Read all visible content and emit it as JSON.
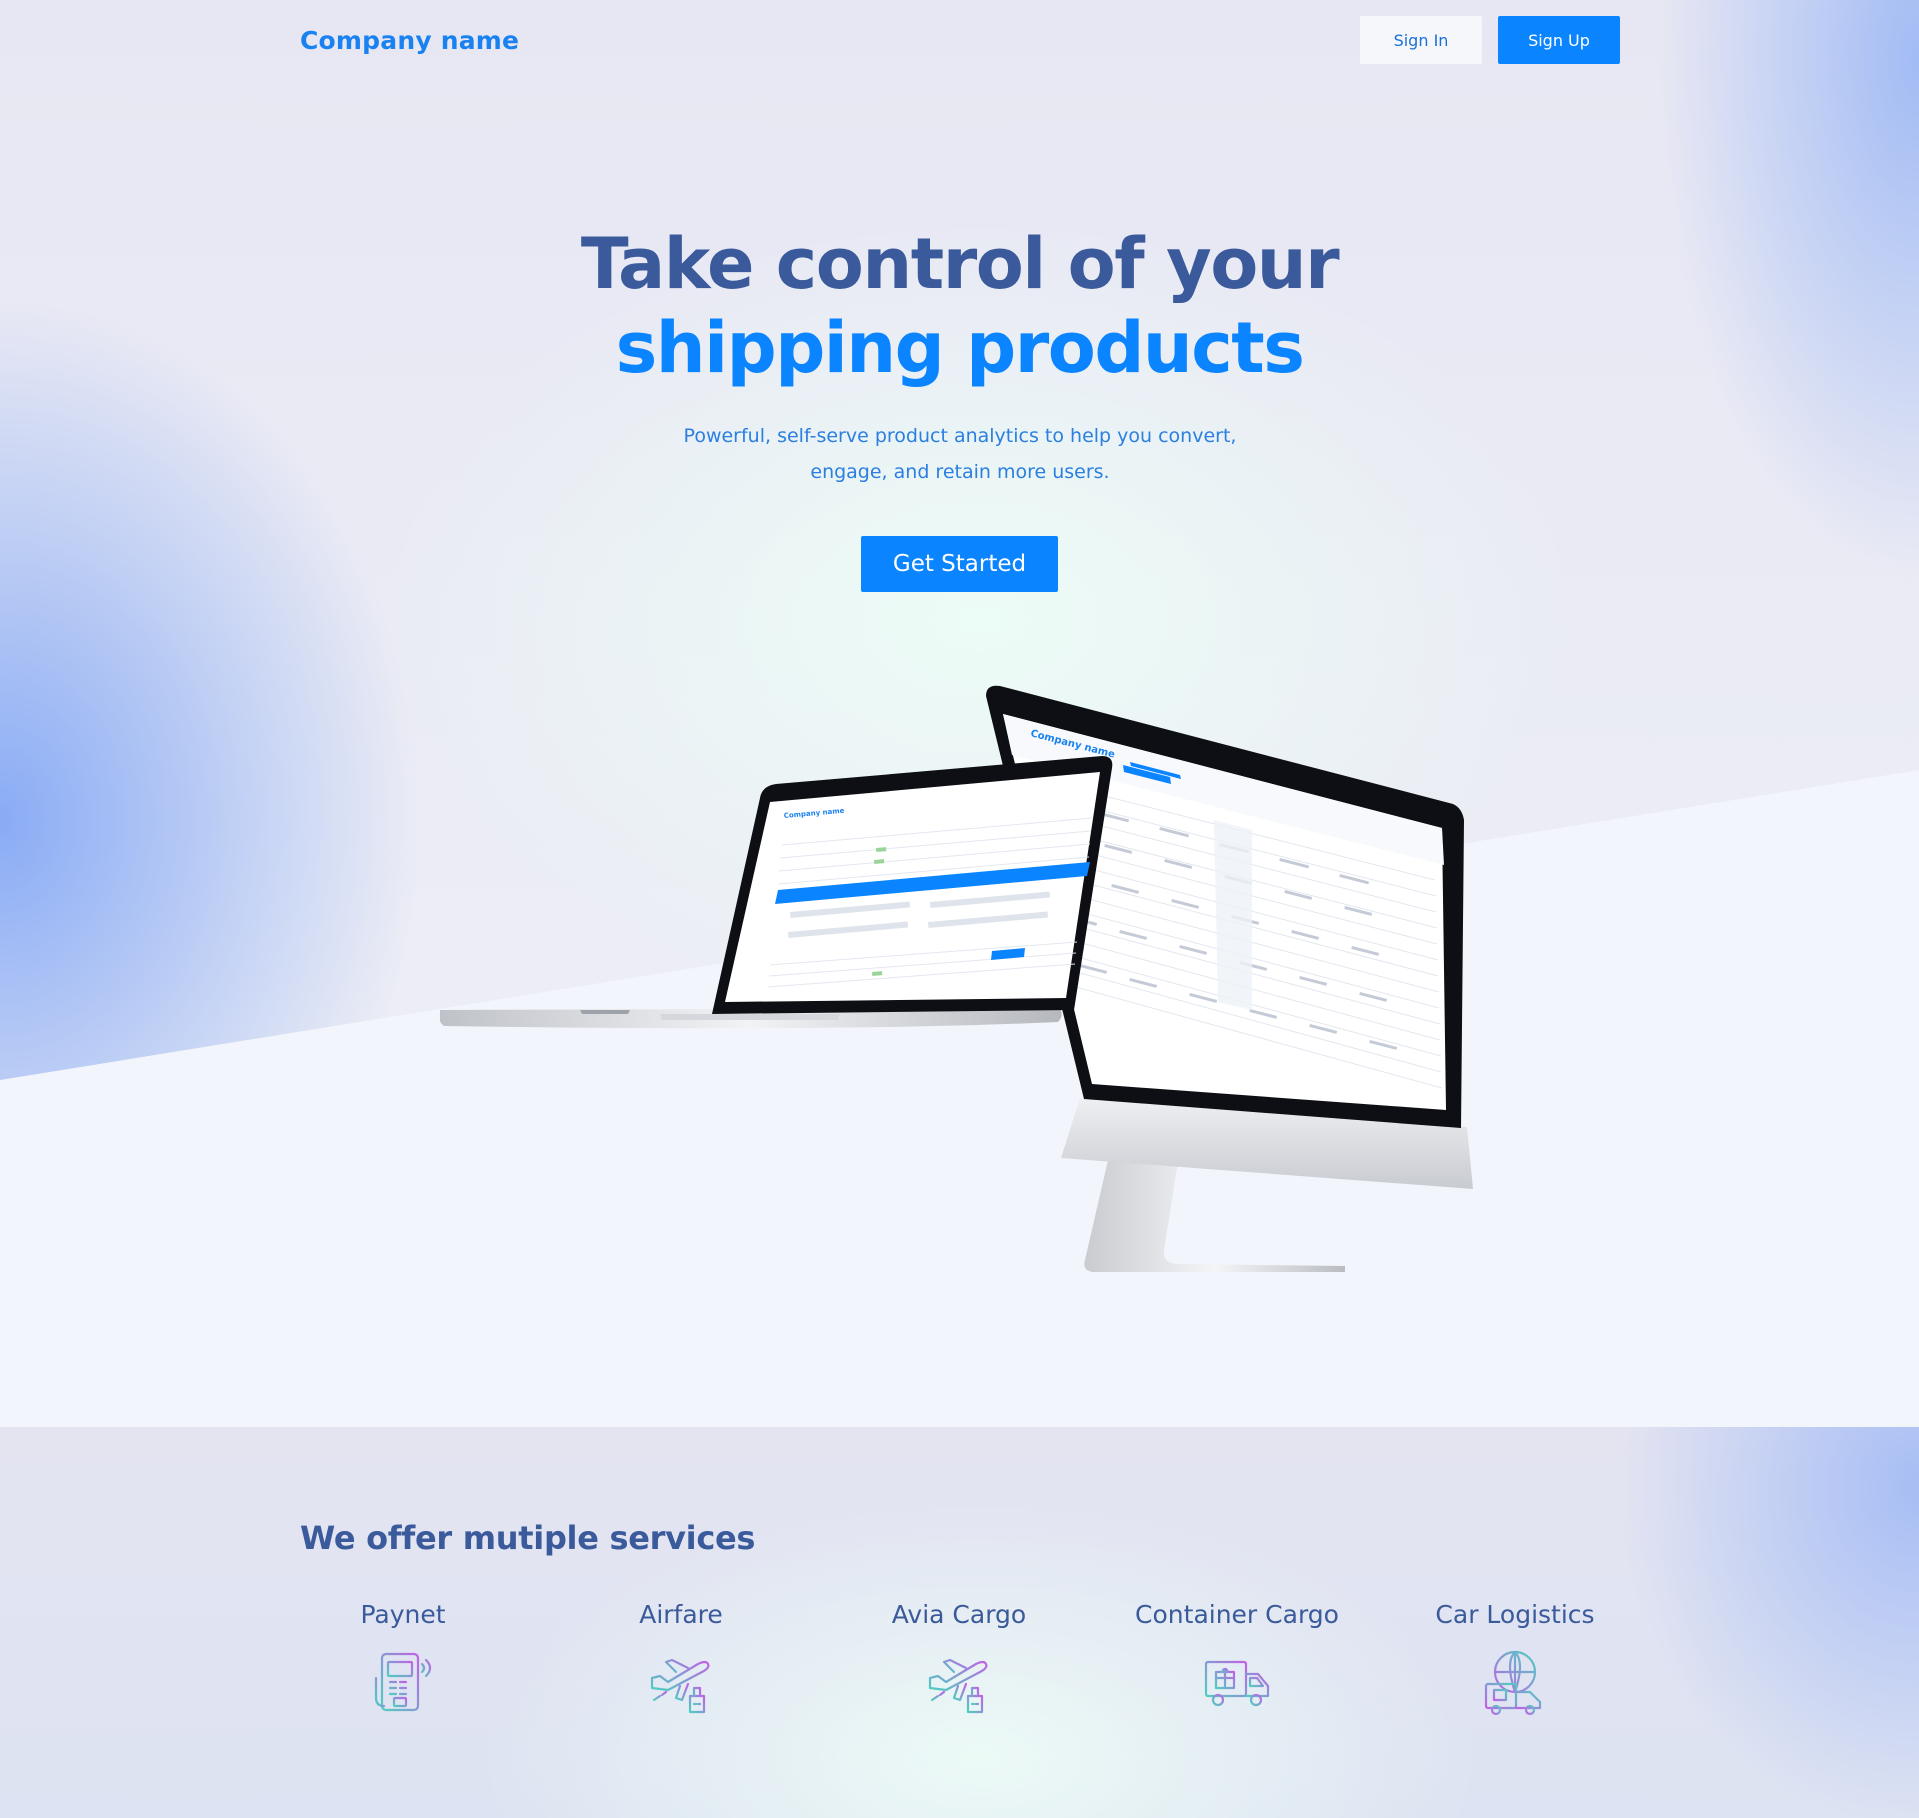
{
  "nav": {
    "brand": "Company name",
    "sign_in": "Sign In",
    "sign_up": "Sign Up"
  },
  "hero": {
    "title_line1": "Take control of  your",
    "title_line2": "shipping products",
    "subtitle_line1": "Powerful, self-serve product analytics to help you convert,",
    "subtitle_line2": "engage, and retain more users.",
    "cta": "Get Started"
  },
  "mockup": {
    "screen_brand": "Company name"
  },
  "services": {
    "title": "We offer mutiple services",
    "items": [
      {
        "label": "Paynet",
        "icon": "payment-terminal-icon"
      },
      {
        "label": "Airfare",
        "icon": "airplane-icon"
      },
      {
        "label": "Avia Cargo",
        "icon": "airplane-cargo-icon"
      },
      {
        "label": "Container Cargo",
        "icon": "delivery-truck-icon"
      },
      {
        "label": "Car Logistics",
        "icon": "global-logistics-icon"
      }
    ]
  },
  "colors": {
    "primary": "#0a84ff",
    "heading": "#3a5a9b",
    "brand_text": "#1a82f0"
  }
}
